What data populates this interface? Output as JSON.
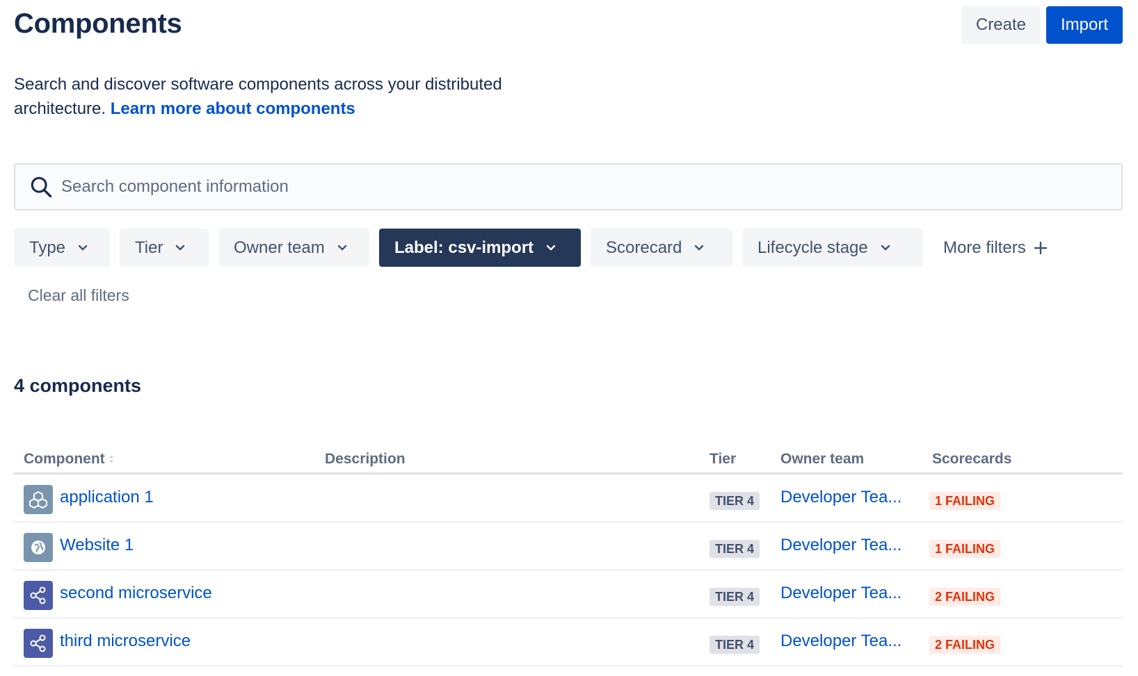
{
  "header": {
    "title": "Components",
    "create_label": "Create",
    "import_label": "Import"
  },
  "intro": {
    "text": "Search and discover software components across your distributed architecture.",
    "link_text": "Learn more about components"
  },
  "search": {
    "placeholder": "Search component information",
    "icon": "search-icon"
  },
  "filters": {
    "type": "Type",
    "tier": "Tier",
    "owner_team": "Owner team",
    "label": "Label: csv-import",
    "scorecard": "Scorecard",
    "lifecycle": "Lifecycle stage",
    "more": "More filters",
    "clear_all": "Clear all filters"
  },
  "results": {
    "count_text": "4 components"
  },
  "table": {
    "columns": {
      "component": "Component",
      "description": "Description",
      "tier": "Tier",
      "owner_team": "Owner team",
      "scorecards": "Scorecards"
    },
    "rows": [
      {
        "icon": "application-icon",
        "name": "application 1",
        "description": "",
        "tier": "TIER 4",
        "owner": "Developer Tea...",
        "scorecard": "1 FAILING"
      },
      {
        "icon": "website-icon",
        "name": "Website 1",
        "description": "",
        "tier": "TIER 4",
        "owner": "Developer Tea...",
        "scorecard": "1 FAILING"
      },
      {
        "icon": "service-icon",
        "name": "second microservice",
        "description": "",
        "tier": "TIER 4",
        "owner": "Developer Tea...",
        "scorecard": "2 FAILING"
      },
      {
        "icon": "service-icon",
        "name": "third microservice",
        "description": "",
        "tier": "TIER 4",
        "owner": "Developer Tea...",
        "scorecard": "2 FAILING"
      }
    ]
  },
  "colors": {
    "primary": "#0052cc",
    "text": "#172b4d",
    "subtle_text": "#5e6c84",
    "active_filter_bg": "#253858",
    "failing_text": "#de350b",
    "failing_bg": "#ffebe6",
    "neutral_bg": "#f4f5f7"
  }
}
